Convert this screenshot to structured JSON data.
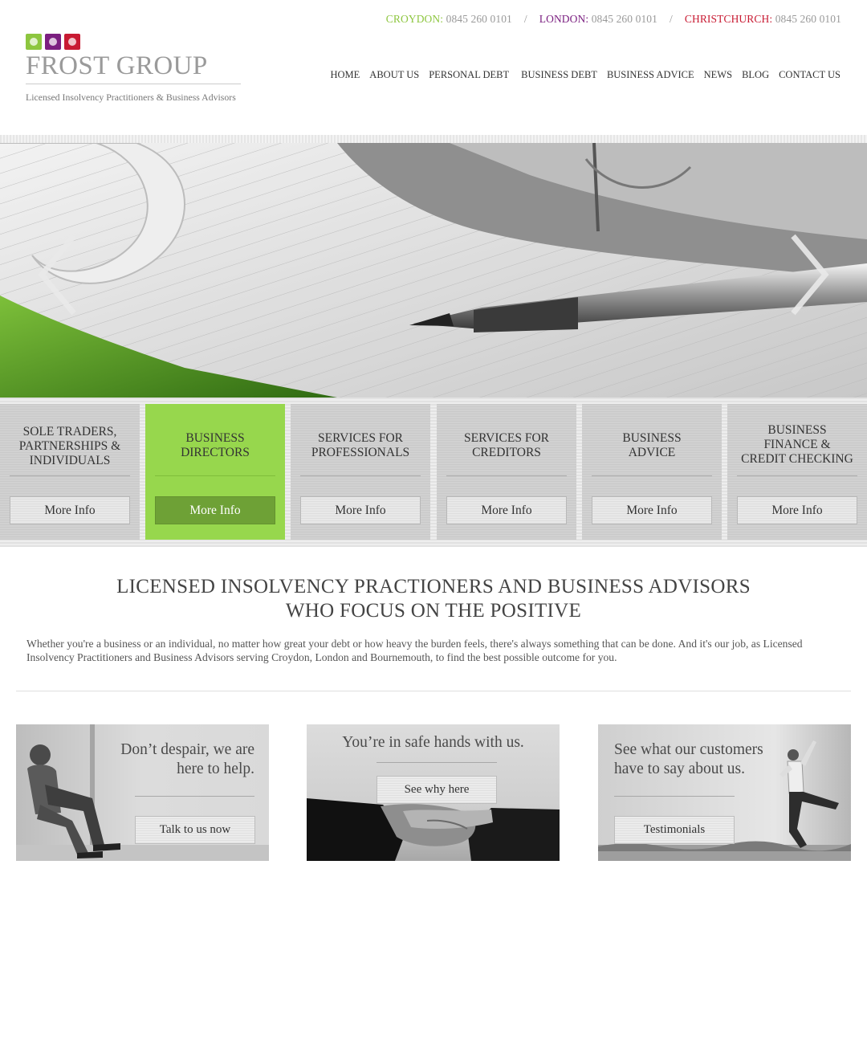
{
  "colors": {
    "green": "#8dc63f",
    "purple": "#7b1f80",
    "red": "#c81a32",
    "active_tile": "#97d74d",
    "active_button": "#6ea136"
  },
  "contacts": [
    {
      "city": "CROYDON:",
      "phone": "0845 260 0101",
      "color": "#8dc63f"
    },
    {
      "city": "LONDON:",
      "phone": "0845 260 0101",
      "color": "#7b1f80"
    },
    {
      "city": "CHRISTCHURCH:",
      "phone": "0845 260 0101",
      "color": "#c81a32"
    }
  ],
  "contact_separator": "/",
  "logo": {
    "name": "FROST GROUP",
    "tagline": "Licensed Insolvency Practitioners & Business Advisors",
    "icons": [
      "flower-icon",
      "bird-icon",
      "dice-icon"
    ]
  },
  "nav": [
    "HOME",
    "ABOUT US",
    "PERSONAL DEBT",
    "BUSINESS DEBT",
    "BUSINESS ADVICE",
    "NEWS",
    "BLOG",
    "CONTACT US"
  ],
  "hero": {
    "prev_icon": "chevron-left-icon",
    "next_icon": "chevron-right-icon"
  },
  "services": [
    {
      "title": "SOLE TRADERS,\nPARTNERSHIPS &\nINDIVIDUALS",
      "button": "More Info",
      "active": false
    },
    {
      "title": "BUSINESS\nDIRECTORS",
      "button": "More Info",
      "active": true
    },
    {
      "title": "SERVICES FOR\nPROFESSIONALS",
      "button": "More Info",
      "active": false
    },
    {
      "title": "SERVICES FOR\nCREDITORS",
      "button": "More Info",
      "active": false
    },
    {
      "title": "BUSINESS\nADVICE",
      "button": "More Info",
      "active": false
    },
    {
      "title": "BUSINESS\nFINANCE &\nCREDIT CHECKING",
      "button": "More Info",
      "active": false
    }
  ],
  "intro": {
    "title_line1": "LICENSED INSOLVENCY PRACTIONERS AND BUSINESS ADVISORS",
    "title_line2": "WHO FOCUS ON THE POSITIVE",
    "text": "Whether you're a business or an individual, no matter how great your debt or how heavy the burden feels, there's always something that can be done.  And it's our job, as Licensed Insolvency Practitioners and Business Advisors serving Croydon, London and Bournemouth, to find the best possible outcome for you."
  },
  "promos": [
    {
      "text": "Don’t despair, we are\nhere to help.",
      "button": "Talk to us now"
    },
    {
      "text": "You’re in safe hands with us.",
      "button": "See why here"
    },
    {
      "text": "See what our customers\nhave to say about us.",
      "button": "Testimonials"
    }
  ]
}
